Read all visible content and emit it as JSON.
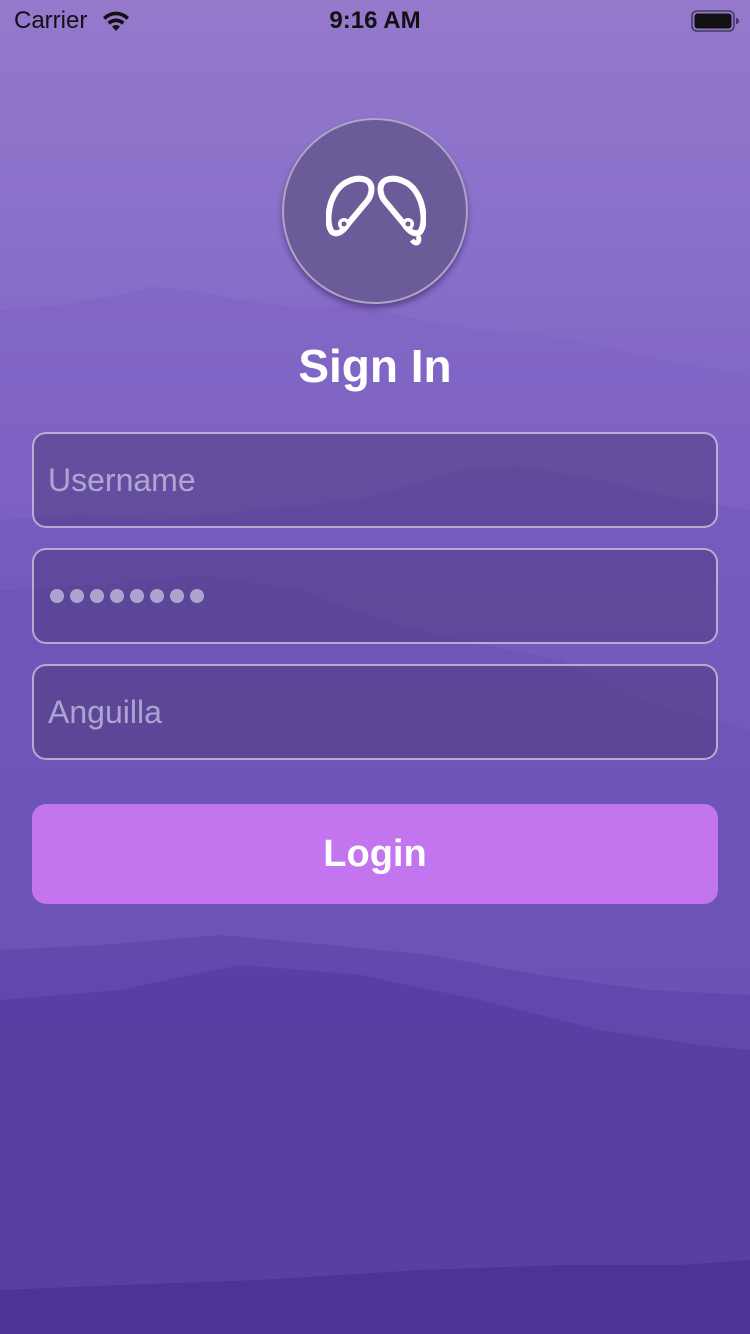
{
  "status_bar": {
    "carrier": "Carrier",
    "time": "9:16 AM"
  },
  "logo": {
    "icon": "earbuds-icon"
  },
  "title": "Sign In",
  "form": {
    "username_placeholder": "Username",
    "password_masked_count": 8,
    "country_value": "Anguilla",
    "login_label": "Login"
  },
  "colors": {
    "accent": "#c374ef",
    "background_top": "#9479cc",
    "background_bottom": "#4d3596"
  }
}
